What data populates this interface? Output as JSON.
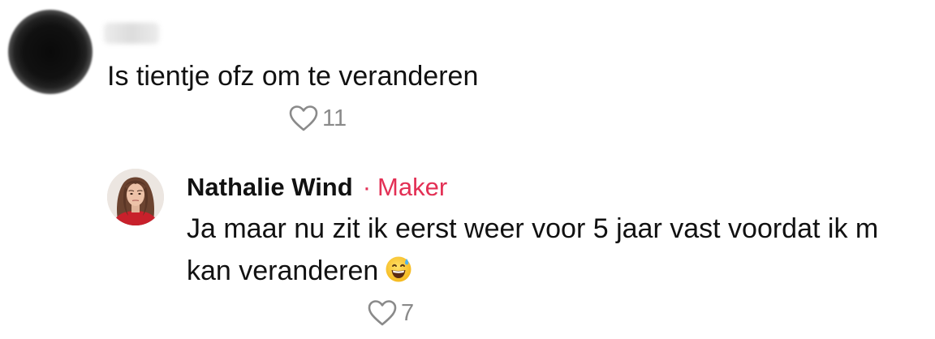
{
  "comment": {
    "text": "Is tientje ofz om te veranderen",
    "likes": "11"
  },
  "reply": {
    "author": "Nathalie Wind",
    "separator": "·",
    "role": "Maker",
    "text_line_1": "Ja maar nu zit ik eerst weer voor 5 jaar vast voordat ik m",
    "text_line_2": "kan veranderen",
    "emoji": "grinning-face-with-sweat-emoji",
    "likes": "7"
  },
  "icons": {
    "like": "heart-outline-icon"
  },
  "colors": {
    "text": "#111111",
    "maker_accent": "#e33055",
    "like_count": "#8a8a8a"
  }
}
